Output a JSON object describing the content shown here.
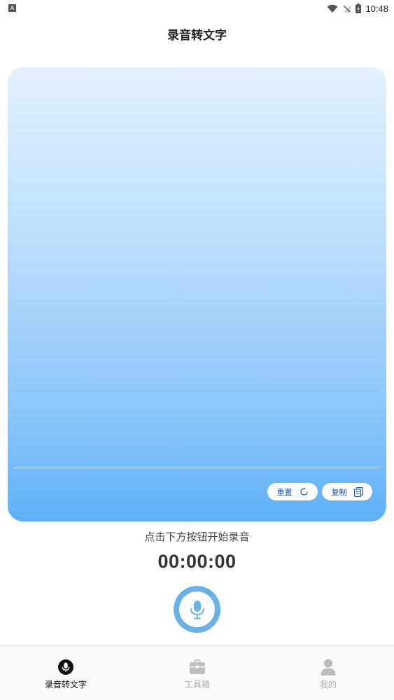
{
  "status_bar": {
    "left_icon": "A",
    "time": "10:48",
    "icons": [
      "wifi-icon",
      "no-signal-icon",
      "battery-charging-icon"
    ]
  },
  "header": {
    "title": "录音转文字"
  },
  "card": {
    "reset_label": "重置",
    "copy_label": "复制",
    "gradient_colors": [
      "#e4f2fd",
      "#5fb1f7"
    ]
  },
  "recorder": {
    "hint": "点击下方按钮开始录音",
    "timer": "00:00:00",
    "accent_color": "#6ab2e6"
  },
  "bottom_nav": {
    "items": [
      {
        "label": "录音转文字",
        "icon": "mic-icon",
        "active": true
      },
      {
        "label": "工具箱",
        "icon": "toolbox-icon",
        "active": false
      },
      {
        "label": "我的",
        "icon": "person-icon",
        "active": false
      }
    ]
  }
}
